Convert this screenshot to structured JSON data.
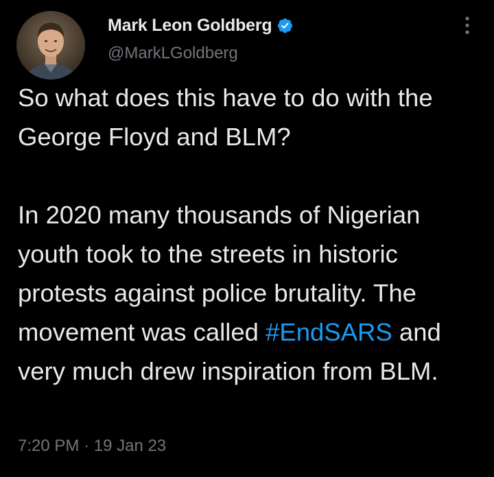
{
  "author": {
    "name": "Mark Leon Goldberg",
    "handle": "@MarkLGoldberg",
    "verified_icon": "verified-badge-icon",
    "verified_color": "#1d9bf0"
  },
  "more_button": {
    "icon": "more-vertical-icon"
  },
  "tweet": {
    "paragraph_1": "So what does this have to do with the George Floyd and BLM?",
    "paragraph_2_before": "In 2020 many thousands of Nigerian youth took to the streets in historic protests against police brutality. The movement was called ",
    "hashtag": "#EndSARS",
    "paragraph_2_after": " and very much drew inspiration from BLM."
  },
  "meta": {
    "time": "7:20 PM",
    "separator": "·",
    "date": "19 Jan 23"
  },
  "colors": {
    "background": "#000000",
    "text": "#e7e9ea",
    "muted": "#71767b",
    "accent": "#1d9bf0"
  }
}
